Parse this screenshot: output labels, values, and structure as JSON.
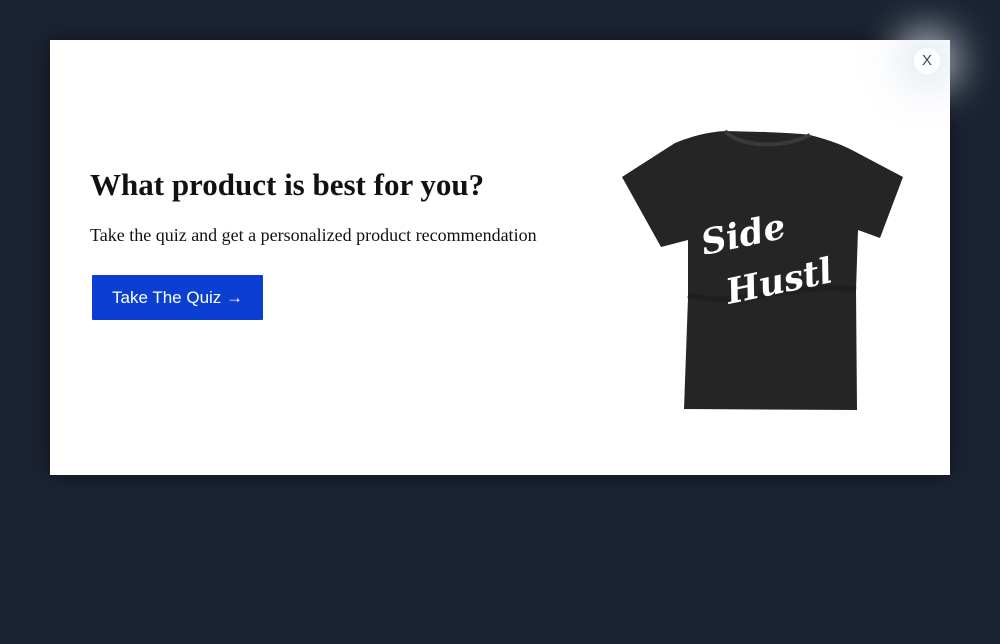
{
  "modal": {
    "close_label": "X",
    "headline": "What product is best for you?",
    "subtext": "Take the quiz and get a personalized product recommendation",
    "cta_label": "Take The Quiz →"
  },
  "product_image": {
    "print_line_1": "Side",
    "print_line_2": "Hustl",
    "shirt_color": "#252525",
    "print_color": "#ffffff"
  },
  "colors": {
    "background": "#1b2231",
    "cta": "#0a3fd1"
  }
}
